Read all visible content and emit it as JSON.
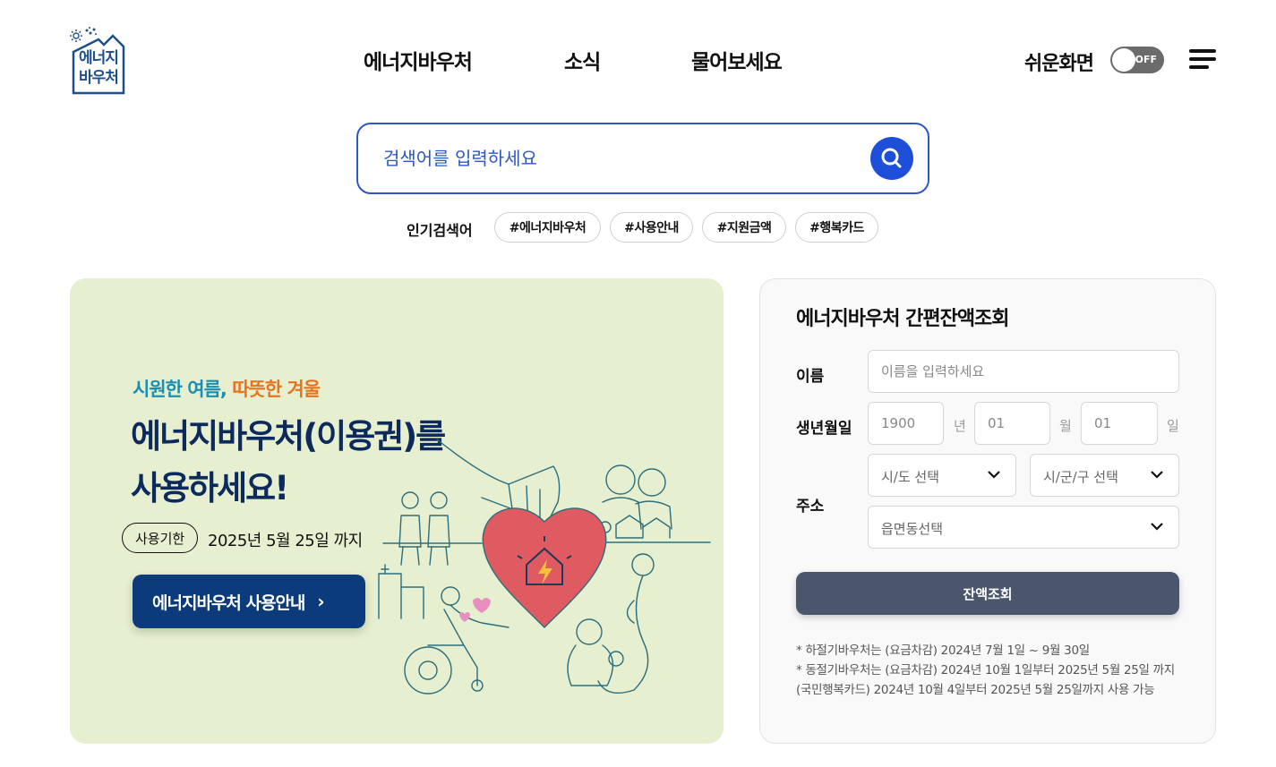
{
  "header": {
    "logo_lines": [
      "에너지",
      "바우처"
    ],
    "nav": [
      "에너지바우처",
      "소식",
      "물어보세요"
    ],
    "easy_screen_label": "쉬운화면",
    "toggle_state": "OFF"
  },
  "search": {
    "placeholder": "검색어를 입력하세요",
    "popular_label": "인기검색어",
    "tags": [
      "#에너지바우처",
      "#사용안내",
      "#지원금액",
      "#행복카드"
    ]
  },
  "banner": {
    "subtitle_part1": "시원한 여름,",
    "subtitle_part2": "따뜻한 겨울",
    "title_line1": "에너지바우처(이용권)를",
    "title_line2": "사용하세요!",
    "period_badge": "사용기한",
    "period_text": "2025년 5월 25일 까지",
    "button_label": "에너지바우처 사용안내"
  },
  "balance": {
    "title": "에너지바우처 간편잔액조회",
    "name_label": "이름",
    "name_placeholder": "이름을 입력하세요",
    "birth_label": "생년월일",
    "year_placeholder": "1900",
    "month_placeholder": "01",
    "day_placeholder": "01",
    "year_unit": "년",
    "month_unit": "월",
    "day_unit": "일",
    "address_label": "주소",
    "sido_select": "시/도 선택",
    "sigungu_select": "시/군/구 선택",
    "eup_select": "읍면동선택",
    "submit_label": "잔액조회",
    "notes": [
      "* 하절기바우처는 (요금차감) 2024년 7월 1일 ~ 9월 30일",
      "* 동절기바우처는 (요금차감) 2024년 10월 1일부터 2025년 5월 25일 까지 (국민행복카드) 2024년 10월 4일부터 2025년 5월 25일까지 사용 가능"
    ]
  },
  "colors": {
    "accent_blue": "#1d4fd8",
    "banner_bg": "#e6efcf",
    "banner_navy": "#0b3b7a",
    "submit_gray": "#4a566c",
    "subtitle_blue": "#1b8fb3",
    "subtitle_orange": "#e6741f"
  }
}
